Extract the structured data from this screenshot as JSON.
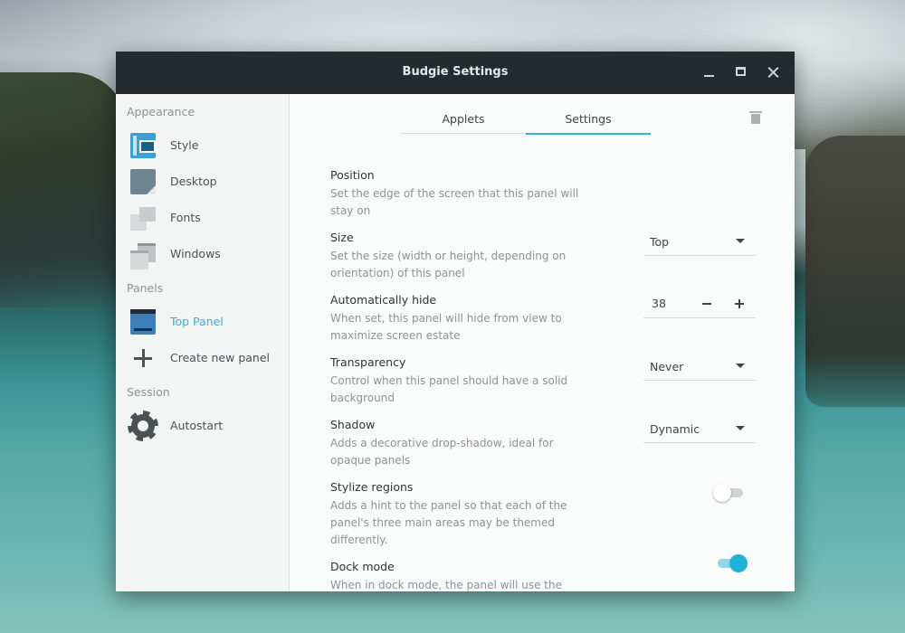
{
  "window": {
    "title": "Budgie Settings"
  },
  "sidebar": {
    "sections": [
      {
        "heading": "Appearance",
        "items": [
          {
            "label": "Style",
            "icon": "style-icon"
          },
          {
            "label": "Desktop",
            "icon": "desktop-icon"
          },
          {
            "label": "Fonts",
            "icon": "fonts-icon"
          },
          {
            "label": "Windows",
            "icon": "windows-icon"
          }
        ]
      },
      {
        "heading": "Panels",
        "items": [
          {
            "label": "Top Panel",
            "icon": "panel-icon",
            "active": true
          },
          {
            "label": "Create new panel",
            "icon": "plus-icon"
          }
        ]
      },
      {
        "heading": "Session",
        "items": [
          {
            "label": "Autostart",
            "icon": "gear-icon"
          }
        ]
      }
    ]
  },
  "tabs": [
    {
      "label": "Applets",
      "active": false
    },
    {
      "label": "Settings",
      "active": true
    }
  ],
  "settings": [
    {
      "name": "Position",
      "desc": "Set the edge of the screen that this panel will stay on",
      "control": "combo",
      "value": "Top"
    },
    {
      "name": "Size",
      "desc": "Set the size (width or height, depending on orientation) of this panel",
      "control": "spin",
      "value": "38"
    },
    {
      "name": "Automatically hide",
      "desc": "When set, this panel will hide from view to maximize screen estate",
      "control": "combo",
      "value": "Never"
    },
    {
      "name": "Transparency",
      "desc": "Control when this panel should have a solid background",
      "control": "combo",
      "value": "Dynamic"
    },
    {
      "name": "Shadow",
      "desc": "Adds a decorative drop-shadow, ideal for opaque panels",
      "control": "switch",
      "value": false
    },
    {
      "name": "Stylize regions",
      "desc": "Adds a hint to the panel so that each of the panel's three main areas may be themed differently.",
      "control": "switch",
      "value": true
    },
    {
      "name": "Dock mode",
      "desc": "When in dock mode, the panel will use the",
      "control": "switch",
      "value": false
    }
  ],
  "colors": {
    "accent": "#2fb7d6",
    "titlebar": "#232b2f",
    "switch_on": "#1eb2d6"
  },
  "icons": {
    "trash": "trash-icon"
  }
}
